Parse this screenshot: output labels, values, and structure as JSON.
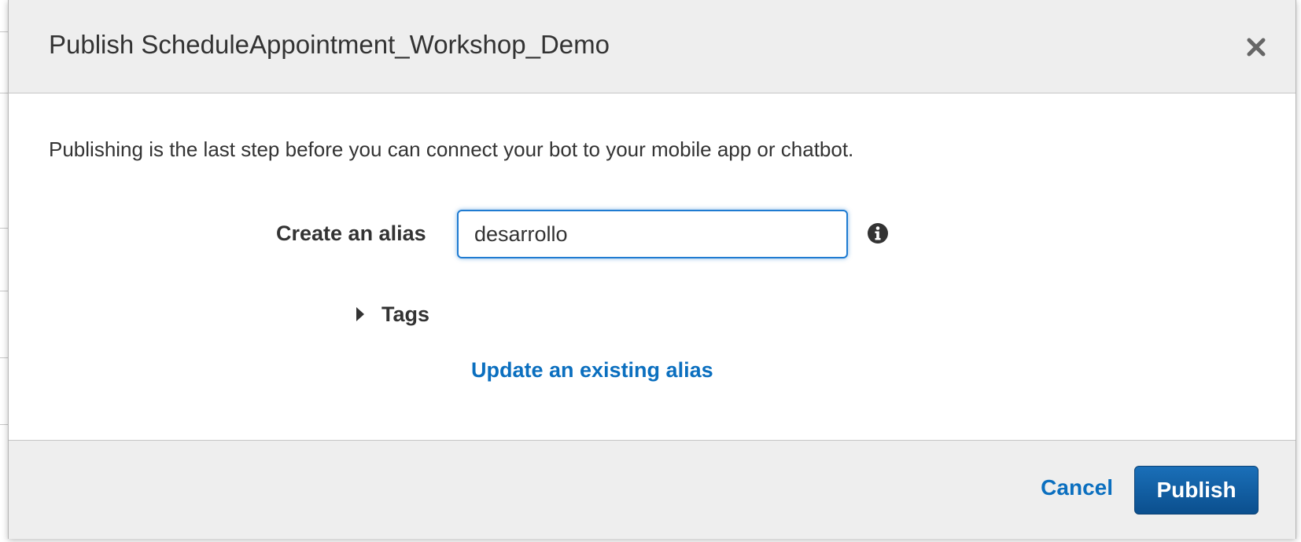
{
  "modal": {
    "title": "Publish ScheduleAppointment_Workshop_Demo",
    "intro": "Publishing is the last step before you can connect your bot to your mobile app or chatbot.",
    "alias": {
      "label": "Create an alias",
      "value": "desarrollo"
    },
    "tags_label": "Tags",
    "update_link": "Update an existing alias",
    "cancel_label": "Cancel",
    "publish_label": "Publish"
  },
  "colors": {
    "header_bg": "#eeeeee",
    "link": "#0b6fbf",
    "primary_button": "#0b4f8e",
    "input_focus": "#1f7bd1"
  },
  "icons": {
    "close": "close-icon",
    "info": "info-icon",
    "expand": "caret-right-icon"
  }
}
